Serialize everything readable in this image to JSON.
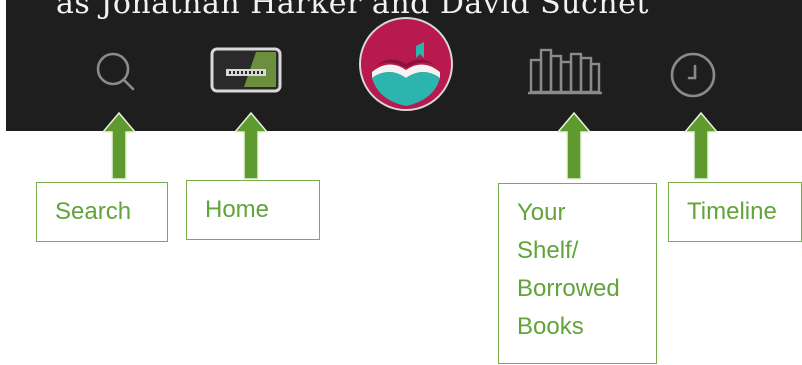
{
  "caption": {
    "text": "as Jonathan Harker and David Suchet"
  },
  "navbar": {
    "background": "#1e1e1e",
    "icon_color": "#8a8a8a",
    "items": [
      {
        "id": "search",
        "icon": "search-icon"
      },
      {
        "id": "home",
        "icon": "home-screen-icon"
      },
      {
        "id": "app",
        "icon": "open-book-logo-icon",
        "logo_colors": [
          "#b8194e",
          "#2bb5ad"
        ]
      },
      {
        "id": "shelf",
        "icon": "bookshelf-icon"
      },
      {
        "id": "timeline",
        "icon": "clock-icon"
      }
    ]
  },
  "annotations": {
    "color": "#62a33a",
    "labels": {
      "search": "Search",
      "home": "Home",
      "shelf": "Your\nShelf/\nBorrowed\nBooks",
      "timeline": "Timeline"
    }
  }
}
